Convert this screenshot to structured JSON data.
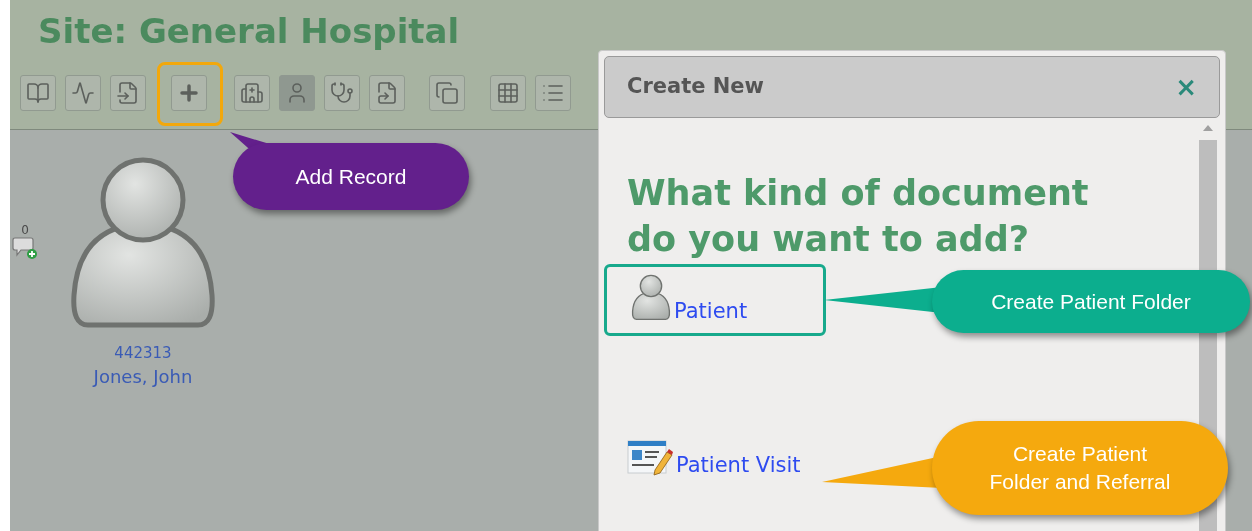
{
  "site_title": "Site: General Hospital",
  "toolbar": [
    {
      "kind": "book",
      "selected": false,
      "highlighted": false
    },
    {
      "kind": "pulse",
      "selected": false,
      "highlighted": false
    },
    {
      "kind": "document",
      "selected": false,
      "highlighted": false
    },
    {
      "kind": "add",
      "selected": false,
      "highlighted": true
    },
    {
      "kind": "building",
      "selected": false,
      "highlighted": false
    },
    {
      "kind": "person",
      "selected": true,
      "highlighted": false
    },
    {
      "kind": "stethoscope",
      "selected": false,
      "highlighted": false
    },
    {
      "kind": "share",
      "selected": false,
      "highlighted": false
    },
    {
      "kind": "copy",
      "selected": false,
      "highlighted": false
    },
    {
      "kind": "grid",
      "selected": false,
      "highlighted": false
    },
    {
      "kind": "list",
      "selected": false,
      "highlighted": false
    }
  ],
  "patient_card": {
    "comment_count": "0",
    "id": "442313",
    "name": "Jones, John"
  },
  "dialog": {
    "title": "Create New",
    "close": "×",
    "question": "What kind of document do you want to add?",
    "options": [
      {
        "kind": "patient",
        "label": "Patient",
        "highlighted": true
      },
      {
        "kind": "visit",
        "label": "Patient Visit",
        "highlighted": false
      }
    ]
  },
  "callouts": [
    {
      "text": "Add Record",
      "color": "#63208c"
    },
    {
      "text": "Create Patient Folder",
      "color": "#0cae8e"
    },
    {
      "text": "Create Patient Folder and Referral",
      "color": "#f5a90e"
    }
  ]
}
